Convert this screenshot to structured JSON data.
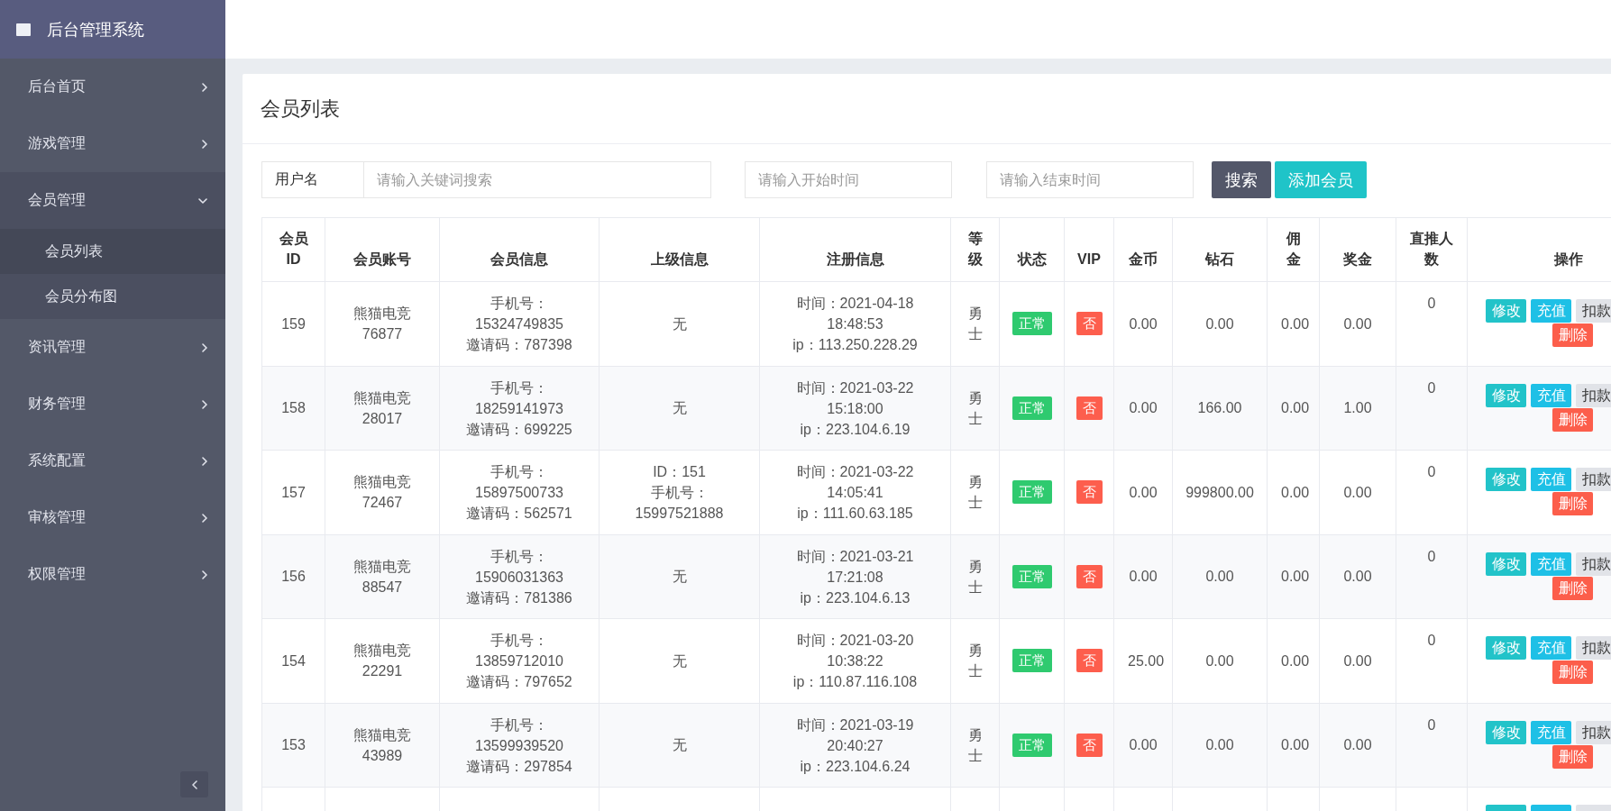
{
  "sidebar": {
    "title": "后台管理系统",
    "items": [
      {
        "label": "后台首页",
        "expanded": false
      },
      {
        "label": "游戏管理",
        "expanded": false
      },
      {
        "label": "会员管理",
        "expanded": true,
        "children": [
          {
            "label": "会员列表",
            "selected": true
          },
          {
            "label": "会员分布图",
            "selected": false
          }
        ]
      },
      {
        "label": "资讯管理",
        "expanded": false
      },
      {
        "label": "财务管理",
        "expanded": false
      },
      {
        "label": "系统配置",
        "expanded": false
      },
      {
        "label": "审核管理",
        "expanded": false
      },
      {
        "label": "权限管理",
        "expanded": false
      }
    ]
  },
  "page": {
    "title": "会员列表"
  },
  "search": {
    "field_label": "用户名",
    "keyword": {
      "placeholder": "请输入关键词搜索"
    },
    "start_time": {
      "placeholder": "请输入开始时间"
    },
    "end_time": {
      "placeholder": "请输入结束时间"
    },
    "buttons": [
      {
        "label": "搜索",
        "kind": "search"
      },
      {
        "label": "添加会员",
        "kind": "add"
      }
    ]
  },
  "table": {
    "columns": [
      "会员ID",
      "会员账号",
      "会员信息",
      "上级信息",
      "注册信息",
      "等级",
      "状态",
      "VIP",
      "金币",
      "钻石",
      "佣金",
      "奖金",
      "直推人数",
      "操作"
    ],
    "rows": [
      {
        "id": "159",
        "account": "熊猫电竞76877",
        "info": {
          "phone": "手机号：15324749835",
          "invite": "邀请码：787398"
        },
        "parent": [
          "无"
        ],
        "registered": {
          "time": "时间：2021-04-18 18:48:53",
          "ip": "ip：113.250.228.29"
        },
        "level": "勇士",
        "status": {
          "label": "正常",
          "on": true
        },
        "vip": {
          "label": "否",
          "on": false
        },
        "coins": "0.00",
        "diamonds": "0.00",
        "commission": "0.00",
        "bonus": "0.00",
        "direct": "0",
        "actions": [
          {
            "label": "修改",
            "kind": "edit"
          },
          {
            "label": "充值",
            "kind": "recharge"
          },
          {
            "label": "扣款",
            "kind": "deduct"
          },
          {
            "label": "删除",
            "kind": "delete"
          }
        ]
      },
      {
        "id": "158",
        "account": "熊猫电竞28017",
        "info": {
          "phone": "手机号：18259141973",
          "invite": "邀请码：699225"
        },
        "parent": [
          "无"
        ],
        "registered": {
          "time": "时间：2021-03-22 15:18:00",
          "ip": "ip：223.104.6.19"
        },
        "level": "勇士",
        "status": {
          "label": "正常",
          "on": true
        },
        "vip": {
          "label": "否",
          "on": false
        },
        "coins": "0.00",
        "diamonds": "166.00",
        "commission": "0.00",
        "bonus": "1.00",
        "direct": "0",
        "actions": [
          {
            "label": "修改",
            "kind": "edit"
          },
          {
            "label": "充值",
            "kind": "recharge"
          },
          {
            "label": "扣款",
            "kind": "deduct"
          },
          {
            "label": "删除",
            "kind": "delete"
          }
        ]
      },
      {
        "id": "157",
        "account": "熊猫电竞72467",
        "info": {
          "phone": "手机号：15897500733",
          "invite": "邀请码：562571"
        },
        "parent": [
          "ID：151",
          "手机号：15997521888"
        ],
        "registered": {
          "time": "时间：2021-03-22 14:05:41",
          "ip": "ip：111.60.63.185"
        },
        "level": "勇士",
        "status": {
          "label": "正常",
          "on": true
        },
        "vip": {
          "label": "否",
          "on": false
        },
        "coins": "0.00",
        "diamonds": "999800.00",
        "commission": "0.00",
        "bonus": "0.00",
        "direct": "0",
        "actions": [
          {
            "label": "修改",
            "kind": "edit"
          },
          {
            "label": "充值",
            "kind": "recharge"
          },
          {
            "label": "扣款",
            "kind": "deduct"
          },
          {
            "label": "删除",
            "kind": "delete"
          }
        ]
      },
      {
        "id": "156",
        "account": "熊猫电竞88547",
        "info": {
          "phone": "手机号：15906031363",
          "invite": "邀请码：781386"
        },
        "parent": [
          "无"
        ],
        "registered": {
          "time": "时间：2021-03-21 17:21:08",
          "ip": "ip：223.104.6.13"
        },
        "level": "勇士",
        "status": {
          "label": "正常",
          "on": true
        },
        "vip": {
          "label": "否",
          "on": false
        },
        "coins": "0.00",
        "diamonds": "0.00",
        "commission": "0.00",
        "bonus": "0.00",
        "direct": "0",
        "actions": [
          {
            "label": "修改",
            "kind": "edit"
          },
          {
            "label": "充值",
            "kind": "recharge"
          },
          {
            "label": "扣款",
            "kind": "deduct"
          },
          {
            "label": "删除",
            "kind": "delete"
          }
        ]
      },
      {
        "id": "154",
        "account": "熊猫电竞22291",
        "info": {
          "phone": "手机号：13859712010",
          "invite": "邀请码：797652"
        },
        "parent": [
          "无"
        ],
        "registered": {
          "time": "时间：2021-03-20 10:38:22",
          "ip": "ip：110.87.116.108"
        },
        "level": "勇士",
        "status": {
          "label": "正常",
          "on": true
        },
        "vip": {
          "label": "否",
          "on": false
        },
        "coins": "25.00",
        "diamonds": "0.00",
        "commission": "0.00",
        "bonus": "0.00",
        "direct": "0",
        "actions": [
          {
            "label": "修改",
            "kind": "edit"
          },
          {
            "label": "充值",
            "kind": "recharge"
          },
          {
            "label": "扣款",
            "kind": "deduct"
          },
          {
            "label": "删除",
            "kind": "delete"
          }
        ]
      },
      {
        "id": "153",
        "account": "熊猫电竞43989",
        "info": {
          "phone": "手机号：13599939520",
          "invite": "邀请码：297854"
        },
        "parent": [
          "无"
        ],
        "registered": {
          "time": "时间：2021-03-19 20:40:27",
          "ip": "ip：223.104.6.24"
        },
        "level": "勇士",
        "status": {
          "label": "正常",
          "on": true
        },
        "vip": {
          "label": "否",
          "on": false
        },
        "coins": "0.00",
        "diamonds": "0.00",
        "commission": "0.00",
        "bonus": "0.00",
        "direct": "0",
        "actions": [
          {
            "label": "修改",
            "kind": "edit"
          },
          {
            "label": "充值",
            "kind": "recharge"
          },
          {
            "label": "扣款",
            "kind": "deduct"
          },
          {
            "label": "删除",
            "kind": "delete"
          }
        ]
      },
      {
        "actions": [
          {
            "kind": "edit"
          },
          {
            "kind": "recharge"
          },
          {
            "kind": "deduct"
          }
        ]
      }
    ]
  }
}
